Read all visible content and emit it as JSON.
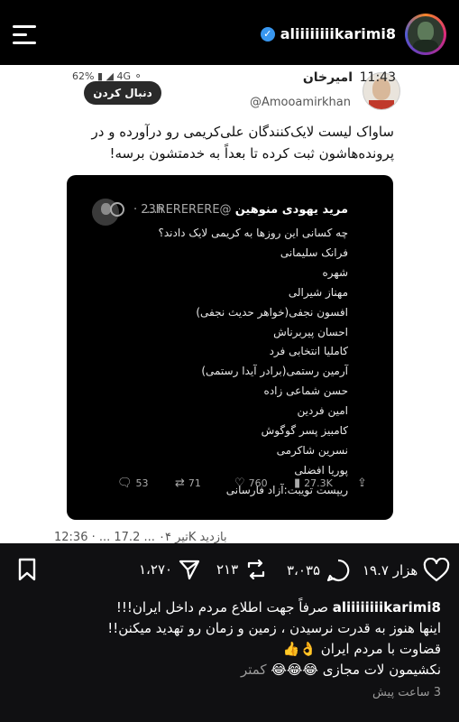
{
  "header": {
    "username": "aliiiiiiiikarimi8"
  },
  "post_image": {
    "phone_status": "62% ▮ ◢ 4G ⚬",
    "follow_button": "دنبال کردن",
    "tweet": {
      "name": "امیرخان",
      "time": "11:43",
      "handle": "@Amooamirkhan",
      "text": "ساواک لیست لایک‌کنندگان علی‌کریمی رو درآورده و در پرونده‌هاشون ثبت کرده تا بعداً به خدمتشون برسه!"
    },
    "quoted": {
      "name": "مرید یهودی منوهین",
      "handle": "@RERERERE...",
      "time": "· 23h",
      "lines": [
        "چه کسانی این روزها به کریمی لایک دادند؟",
        "فرانک سلیمانی",
        "شهره",
        "مهناز شیرالی",
        "افسون نجفی(خواهر حدیث نجفی)",
        "احسان پیربرناش",
        "کاملیا انتخابی فرد",
        "آرمین رستمی(برادر آیدا رستمی)",
        "حسن شماعی زاده",
        "امین فردین",
        "کامبیز پسر گوگوش",
        "نسرین شاکرمی",
        "پوریا افضلی",
        "ریپست تویبت:آزاد فارسانی"
      ],
      "actions": {
        "replies": "53",
        "reposts": "71",
        "likes": "760",
        "views": "27.3K"
      }
    },
    "footer": "12:36 · ... تیر ۰۴ ... 17.2K بازدید"
  },
  "actions": {
    "likes": "۱۹.۷ هزار",
    "comments": "۳،۰۳۵",
    "reposts": "۲۱۳",
    "shares": "۱،۲۷۰"
  },
  "caption": {
    "username": "aliiiiiiiikarimi8",
    "line1": "صرفاً جهت اطلاع مردم داخل ایران!!!",
    "line2": "اینها هنوز به قدرت نرسیدن ، زمین و زمان رو تهدید میکنن!!",
    "line3": "قضاوت با مردم ایران 👌👍",
    "line4": "نکشیمون لات مجازی 😂😂😂",
    "more": "کمتر"
  },
  "time_ago": "3 ساعت پیش",
  "colors": {
    "verified": "#3897f0",
    "background": "#101012"
  }
}
